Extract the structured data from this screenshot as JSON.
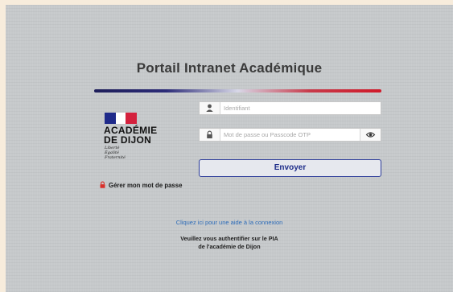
{
  "page": {
    "title": "Portail Intranet Académique"
  },
  "logo": {
    "line1": "ACADÉMIE",
    "line2": "DE DIJON",
    "motto": [
      "Liberté",
      "Égalité",
      "Fraternité"
    ],
    "flag_colors": [
      "#1f2a8a",
      "#ffffff",
      "#d4213d"
    ]
  },
  "form": {
    "identifier_placeholder": "Identifiant",
    "password_placeholder": "Mot de passe ou Passcode OTP",
    "submit_label": "Envoyer",
    "user_icon": "user-icon",
    "lock_icon": "lock-icon",
    "eye_icon": "eye-icon"
  },
  "password_link": {
    "label": "Gérer mon mot de passe",
    "icon": "lock-icon",
    "icon_color": "#d9302b"
  },
  "help_link": "Cliquez ici pour une aide à la connexion",
  "note": {
    "line1": "Veuillez vous authentifier sur le PIA",
    "line2": "de l'académie de Dijon"
  },
  "colors": {
    "accent": "#1f2e8a",
    "link": "#2c6bb8",
    "page_bg": "#f7ecdc"
  }
}
